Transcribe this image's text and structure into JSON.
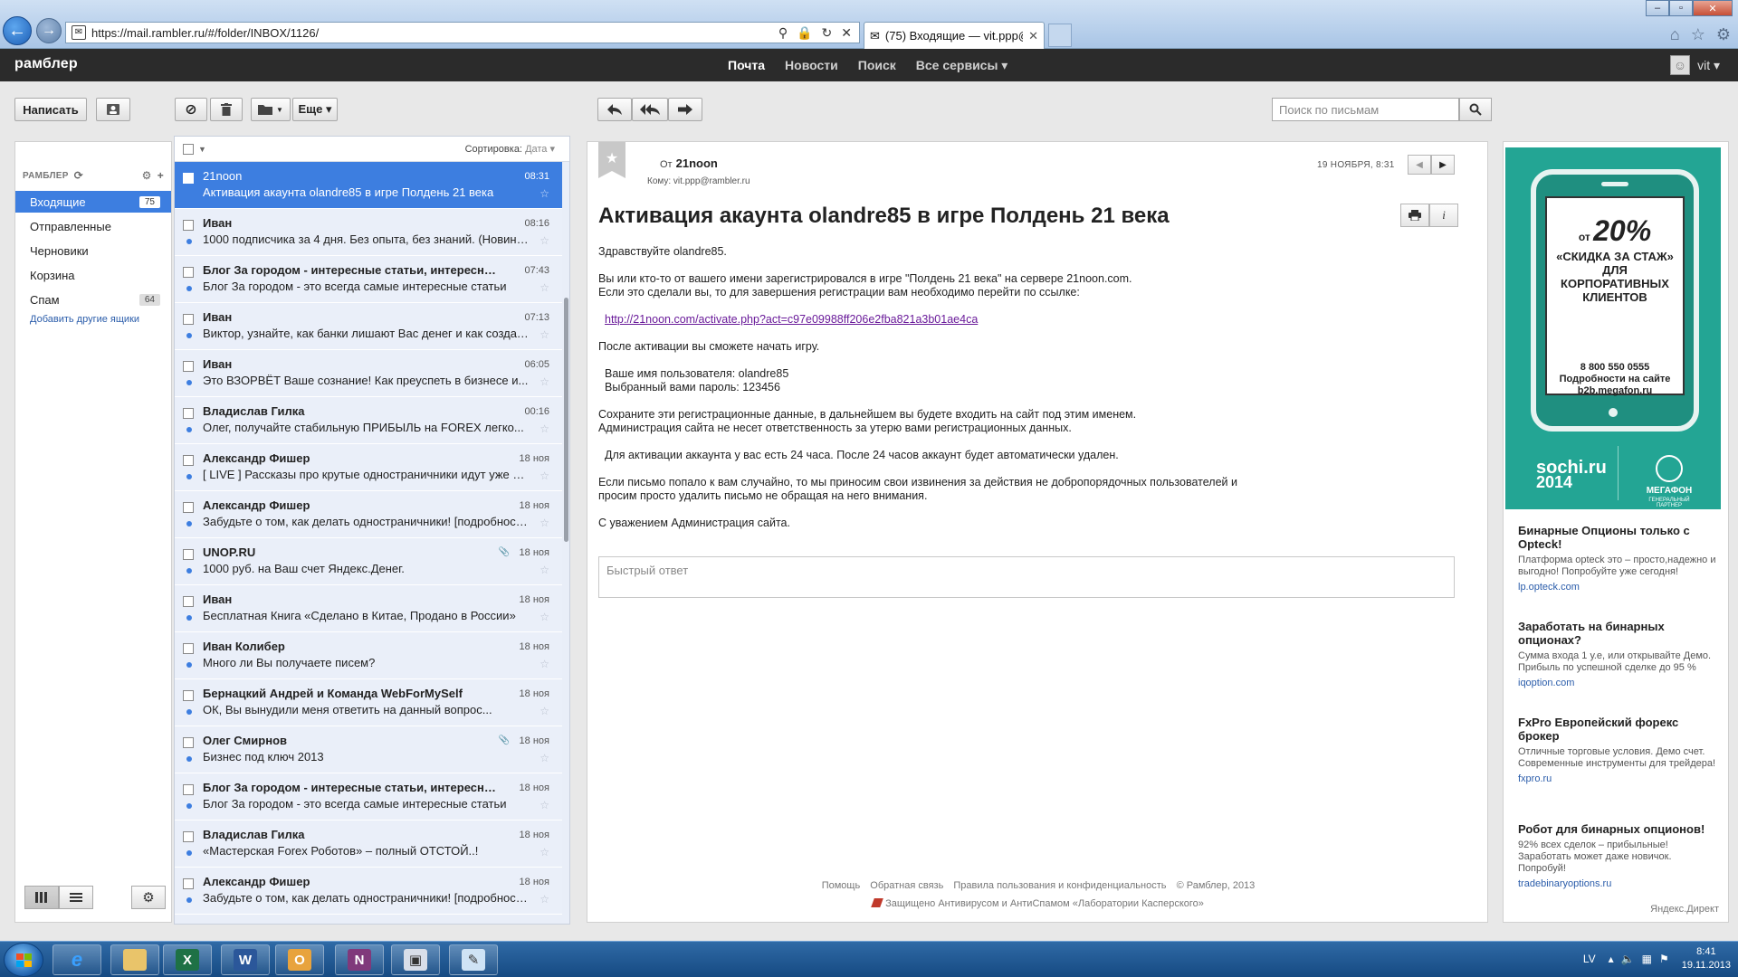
{
  "browser": {
    "url": "https://mail.rambler.ru/#/folder/INBOX/1126/",
    "tab_title": "(75) Входящие — vit.ppp@..."
  },
  "topbar": {
    "logo": "рамблер",
    "nav": [
      "Почта",
      "Новости",
      "Поиск",
      "Все сервисы ▾"
    ],
    "user": "vit ▾"
  },
  "toolbar": {
    "compose": "Написать",
    "more": "Еще ▾",
    "search_placeholder": "Поиск по письмам"
  },
  "sidebar": {
    "header": "РАМБЛЕР",
    "folders": [
      {
        "name": "Входящие",
        "count": "75"
      },
      {
        "name": "Отправленные",
        "count": ""
      },
      {
        "name": "Черновики",
        "count": ""
      },
      {
        "name": "Корзина",
        "count": ""
      },
      {
        "name": "Спам",
        "count": "64"
      }
    ],
    "add_boxes": "Добавить другие ящики"
  },
  "list": {
    "sort_label": "Сортировка:",
    "sort_value": "Дата ▾",
    "rows": [
      {
        "sender": "21noon",
        "time": "08:31",
        "subject": "Активация акаунта olandre85 в игре Полдень 21 века",
        "clip": false
      },
      {
        "sender": "Иван",
        "time": "08:16",
        "subject": "1000 подписчика за 4 дня. Без опыта, без знаний. (Новинка!)",
        "clip": false
      },
      {
        "sender": "Блог За городом - интересные статьи, интересны...",
        "time": "07:43",
        "subject": "Блог За городом - это всегда самые интересные статьи",
        "clip": false
      },
      {
        "sender": "Иван",
        "time": "07:13",
        "subject": "Виктор, узнайте, как банки лишают Вас денег и как создат...",
        "clip": false
      },
      {
        "sender": "Иван",
        "time": "06:05",
        "subject": "Это ВЗОРВЁТ Ваше сознание! Как преуспеть в бизнесе и...",
        "clip": false
      },
      {
        "sender": "Владислав Гилка",
        "time": "00:16",
        "subject": "Олег, получайте стабильную ПРИБЫЛЬ на FOREX легко...",
        "clip": false
      },
      {
        "sender": "Александр Фишер",
        "time": "18 ноя",
        "subject": "[ LIVE ] Рассказы про крутые одностраничники идут уже 1...",
        "clip": false
      },
      {
        "sender": "Александр Фишер",
        "time": "18 ноя",
        "subject": "Забудьте о том, как делать одностраничники! [подробност...",
        "clip": false
      },
      {
        "sender": "UNOP.RU",
        "time": "18 ноя",
        "subject": "1000 руб. на Ваш счет Яндекс.Денег.",
        "clip": true
      },
      {
        "sender": "Иван",
        "time": "18 ноя",
        "subject": "Бесплатная Книга «Сделано в Китае, Продано в России»",
        "clip": false
      },
      {
        "sender": "Иван Колибер",
        "time": "18 ноя",
        "subject": "Много ли Вы получаете писем?",
        "clip": false
      },
      {
        "sender": "Бернацкий Андрей и Команда WebForMySelf",
        "time": "18 ноя",
        "subject": "ОК, Вы вынудили меня ответить на данный вопрос...",
        "clip": false
      },
      {
        "sender": "Олег Смирнов",
        "time": "18 ноя",
        "subject": "Бизнес под ключ 2013",
        "clip": true
      },
      {
        "sender": "Блог За городом - интересные статьи, интересны...",
        "time": "18 ноя",
        "subject": "Блог За городом - это всегда самые интересные статьи",
        "clip": false
      },
      {
        "sender": "Владислав Гилка",
        "time": "18 ноя",
        "subject": "«Мастерская Forex Роботов» – полный ОТСТОЙ..!",
        "clip": false
      },
      {
        "sender": "Александр Фишер",
        "time": "18 ноя",
        "subject": "Забудьте о том, как делать одностраничники! [подробност...",
        "clip": false
      }
    ]
  },
  "message": {
    "from_label": "От",
    "from": "21noon",
    "to": "Кому: vit.ppp@rambler.ru",
    "date": "19 НОЯБРЯ, 8:31",
    "title": "Активация акаунта olandre85 в игре Полдень 21 века",
    "greeting": "Здравствуйте olandre85.",
    "p1a": "Вы или кто-то от вашего имени зарегистрировался в игре \"Полдень 21 века\" на сервере 21noon.com.",
    "p1b": "Если это сделали вы, то для завершения регистрации вам необходимо перейти по ссылке:",
    "link": "http://21noon.com/activate.php?act=c97e09988ff206e2fba821a3b01ae4ca",
    "p2": "После активации вы сможете начать игру.",
    "user": "Ваше имя пользователя: olandre85",
    "pass": "Выбранный вами пароль: 123456",
    "p3a": "Сохраните эти регистрационные данные, в дальнейшем вы будете входить на сайт под этим именем.",
    "p3b": "Администрация сайта не несет ответственность за утерю вами регистрационных данных.",
    "p4": "Для активации аккаунта у вас есть 24 часа. После 24 часов аккаунт будет автоматически удален.",
    "p5a": "Если письмо попало к вам случайно, то мы приносим свои извинения за действия не добропорядочных пользователей и",
    "p5b": "просим просто удалить письмо не обращая на него внимания.",
    "sign": "С уважением Администрация сайта.",
    "quick_reply": "Быстрый ответ"
  },
  "footer": {
    "links": [
      "Помощь",
      "Обратная связь",
      "Правила пользования и конфиденциальность",
      "© Рамблер, 2013"
    ],
    "kaspersky": "Защищено Антивирусом и АнтиСпамом «Лаборатории Касперского»"
  },
  "ads": {
    "banner_from": "от",
    "banner_pct": "20%",
    "banner_line": "«СКИДКА ЗА СТАЖ» ДЛЯ КОРПОРАТИВНЫХ КЛИЕНТОВ",
    "banner_phone": "8 800 550 0555",
    "banner_more": "Подробности на сайте",
    "banner_site": "b2b.megafon.ru",
    "sochi": "sochi.ru",
    "sochi_year": "2014",
    "megafon": "МЕГАФОН",
    "megafon_sub": "ГЕНЕРАЛЬНЫЙ ПАРТНЕР",
    "items": [
      {
        "title": "Бинарные Опционы только с Opteck!",
        "desc": "Платформа opteck это – просто,надежно и выгодно! Попробуйте уже сегодня!",
        "url": "lp.opteck.com"
      },
      {
        "title": "Заработать на бинарных опционах?",
        "desc": "Сумма входа 1 у.е, или открывайте Демо. Прибыль по успешной сделке до 95 %",
        "url": "iqoption.com"
      },
      {
        "title": "FxPro Европейский форекс брокер",
        "desc": "Отличные торговые условия. Демо счет. Современные инструменты для трейдера!",
        "url": "fxpro.ru"
      },
      {
        "title": "Робот для бинарных опционов!",
        "desc": "92% всех сделок – прибыльные! Заработать может даже новичок. Попробуй!",
        "url": "tradebinaryoptions.ru"
      }
    ],
    "yandex": "Яндекс.Директ"
  },
  "taskbar": {
    "lang": "LV",
    "time": "8:41",
    "date": "19.11.2013"
  }
}
